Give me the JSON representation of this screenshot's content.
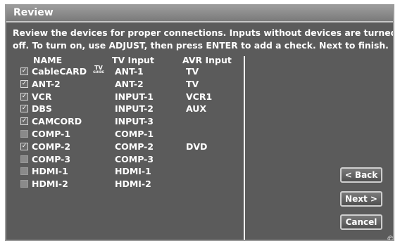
{
  "dialog": {
    "title": "Review",
    "instruction_line1": "Review the devices for proper connections. Inputs without devices are turned",
    "instruction_line2": "off. To turn on, use ADJUST, then press ENTER to add a check.  Next to finish."
  },
  "columns": {
    "name": "NAME",
    "tv_input": "TV  Input",
    "avr_input": "AVR Input"
  },
  "tv_guide_logo": {
    "top": "TV",
    "bottom": "GUIDE"
  },
  "devices": [
    {
      "checked": true,
      "name": "CableCARD",
      "tv_input": "ANT-1",
      "avr_input": "TV"
    },
    {
      "checked": true,
      "name": "ANT-2",
      "tv_input": "ANT-2",
      "avr_input": "TV"
    },
    {
      "checked": true,
      "name": "VCR",
      "tv_input": "INPUT-1",
      "avr_input": "VCR1"
    },
    {
      "checked": true,
      "name": "DBS",
      "tv_input": "INPUT-2",
      "avr_input": "AUX"
    },
    {
      "checked": true,
      "name": "CAMCORD",
      "tv_input": "INPUT-3",
      "avr_input": ""
    },
    {
      "checked": false,
      "name": "COMP-1",
      "tv_input": "COMP-1",
      "avr_input": ""
    },
    {
      "checked": true,
      "name": "COMP-2",
      "tv_input": "COMP-2",
      "avr_input": "DVD"
    },
    {
      "checked": false,
      "name": "COMP-3",
      "tv_input": "COMP-3",
      "avr_input": ""
    },
    {
      "checked": false,
      "name": "HDMI-1",
      "tv_input": "HDMI-1",
      "avr_input": ""
    },
    {
      "checked": false,
      "name": "HDMI-2",
      "tv_input": "HDMI-2",
      "avr_input": ""
    }
  ],
  "buttons": {
    "back": "< Back",
    "next": "Next >",
    "cancel": "Cancel"
  },
  "footer": {
    "copyright_symbol": "©"
  },
  "icons": {
    "check": "✓"
  },
  "colors": {
    "panel": "#5b5b5b",
    "titlebar": "#8c8c8c",
    "text": "#ffffff"
  }
}
